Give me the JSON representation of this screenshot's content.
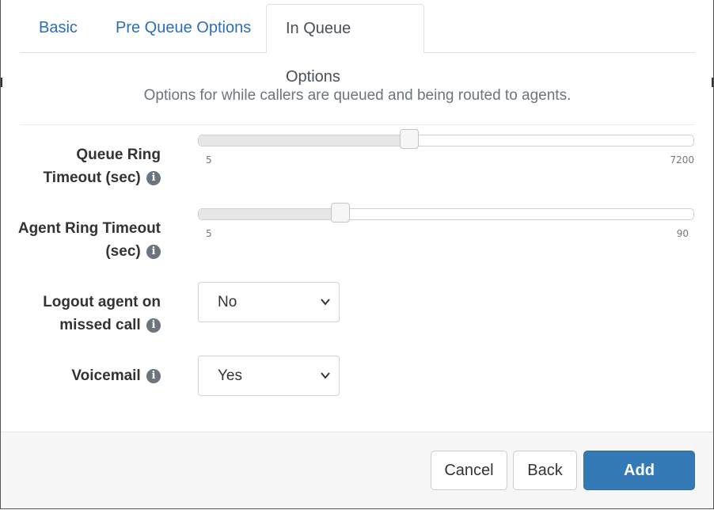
{
  "tabs": [
    {
      "label": "Basic",
      "active": false
    },
    {
      "label": "Pre Queue Options",
      "active": false
    },
    {
      "label": "In Queue Options",
      "active": true
    }
  ],
  "intro": "Options for while callers are queued and being routed to agents.",
  "fields": {
    "queue_ring_timeout": {
      "label_line1": "Queue Ring",
      "label_line2": "Timeout (sec)",
      "min": "5",
      "max": "7200",
      "fill_fraction": 0.425
    },
    "agent_ring_timeout": {
      "label_line1": "Agent Ring Timeout",
      "label_line2": "(sec)",
      "min": "5",
      "max": "90",
      "fill_fraction": 0.285
    },
    "logout_on_missed": {
      "label_line1": "Logout agent on",
      "label_line2": "missed call",
      "value": "No"
    },
    "voicemail": {
      "label": "Voicemail",
      "value": "Yes"
    }
  },
  "info_icon_glyph": "i",
  "footer": {
    "cancel_label": "Cancel",
    "back_label": "Back",
    "add_label": "Add"
  },
  "colors": {
    "link": "#2a6ebb",
    "primary": "#337ab7"
  }
}
